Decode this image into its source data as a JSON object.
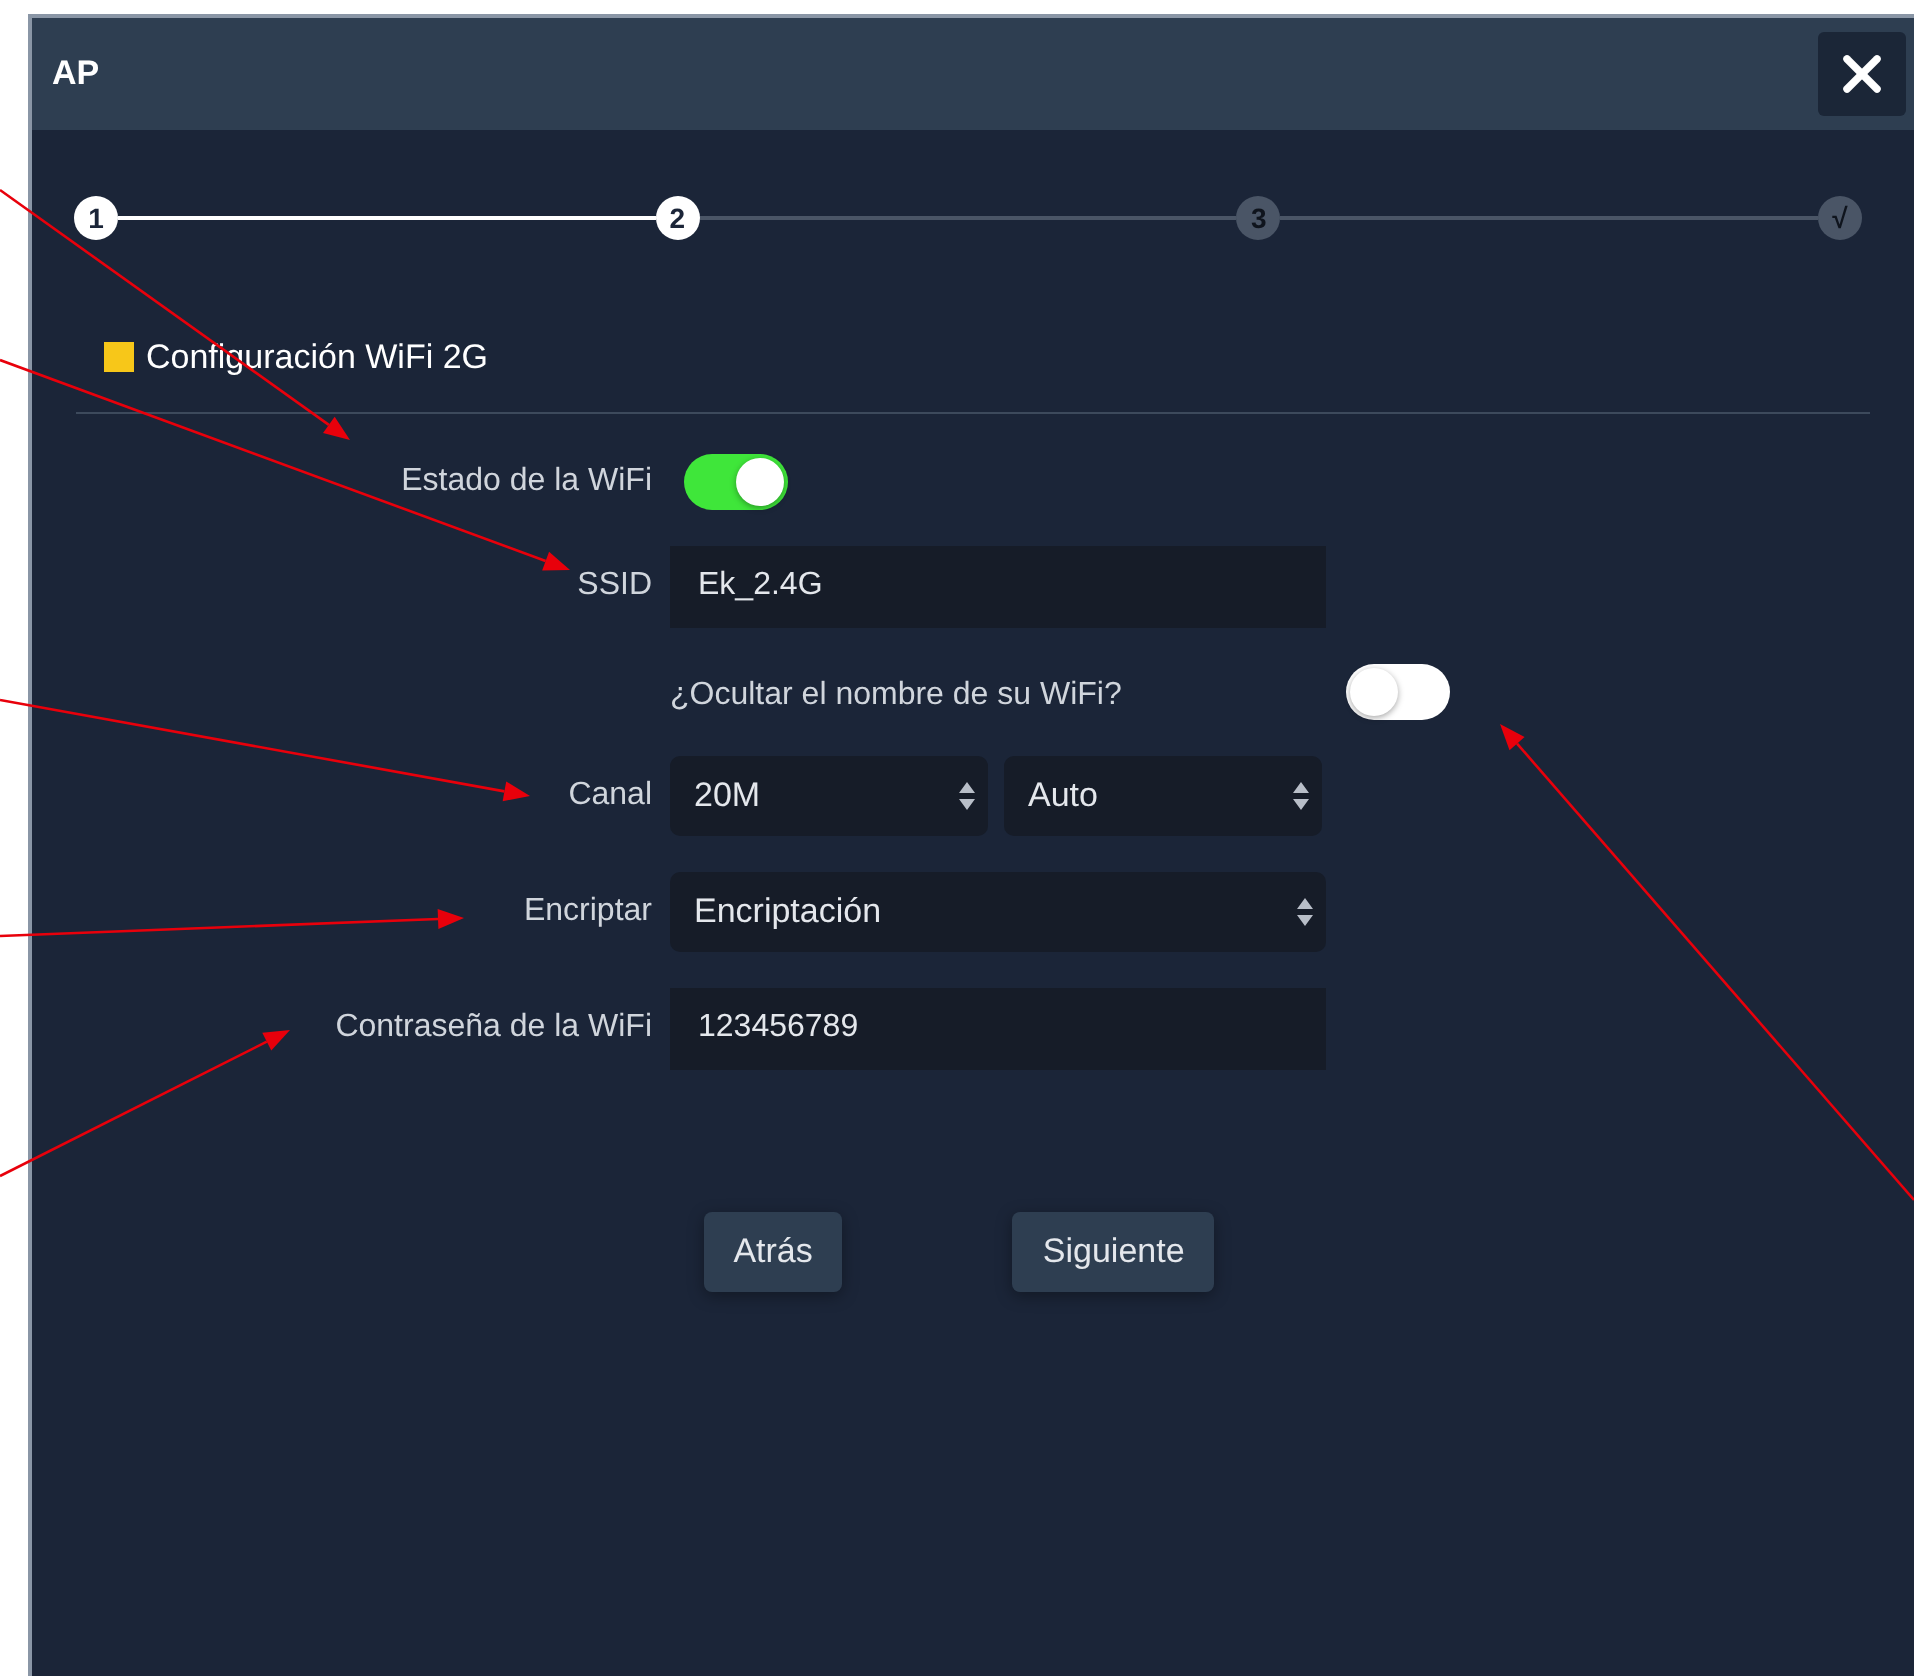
{
  "window": {
    "title": "AP"
  },
  "steps": [
    {
      "label": "1",
      "reached": true
    },
    {
      "label": "2",
      "reached": true
    },
    {
      "label": "3",
      "reached": false
    },
    {
      "label": "√",
      "reached": false
    }
  ],
  "section": {
    "title": "Configuración WiFi 2G"
  },
  "fields": [
    {
      "kind": "toggle",
      "label": "Estado de la WiFi",
      "on": true
    },
    {
      "kind": "input",
      "label": "SSID",
      "value": "Ek_2.4G"
    },
    {
      "kind": "toggle_inline",
      "label": "¿Ocultar el nombre de su WiFi?",
      "on": false
    },
    {
      "kind": "selects",
      "label": "Canal",
      "options": [
        "20M",
        "Auto"
      ]
    },
    {
      "kind": "select",
      "label": "Encriptar",
      "value": "Encriptación"
    },
    {
      "kind": "input",
      "label": "Contraseña de la WiFi",
      "value": "123456789"
    }
  ],
  "buttons": [
    "Atrás",
    "Siguiente"
  ]
}
